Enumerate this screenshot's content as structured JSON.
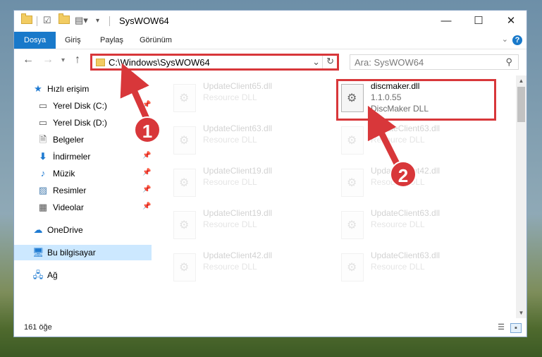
{
  "window": {
    "title": "SysWOW64"
  },
  "ribbon": {
    "tabs": [
      "Dosya",
      "Giriş",
      "Paylaş",
      "Görünüm"
    ]
  },
  "address_bar": {
    "path": "C:\\Windows\\SysWOW64"
  },
  "search": {
    "placeholder": "Ara: SysWOW64"
  },
  "sidebar": {
    "items": [
      {
        "label": "Hızlı erişim",
        "icon": "star-icon"
      },
      {
        "label": "Yerel Disk (C:)",
        "icon": "drive-icon"
      },
      {
        "label": "Yerel Disk (D:)",
        "icon": "drive-icon"
      },
      {
        "label": "Belgeler",
        "icon": "documents-icon"
      },
      {
        "label": "İndirmeler",
        "icon": "download-icon"
      },
      {
        "label": "Müzik",
        "icon": "music-icon"
      },
      {
        "label": "Resimler",
        "icon": "pictures-icon"
      },
      {
        "label": "Videolar",
        "icon": "video-icon"
      },
      {
        "label": "OneDrive",
        "icon": "cloud-icon"
      },
      {
        "label": "Bu bilgisayar",
        "icon": "computer-icon"
      },
      {
        "label": "Ağ",
        "icon": "network-icon"
      }
    ]
  },
  "files": [
    {
      "name": "UpdateClient65.dll",
      "type": "Resource DLL"
    },
    {
      "name": "discmaker.dll",
      "type": "1.1.0.55",
      "desc": "DiscMaker DLL"
    },
    {
      "name": "UpdateClient63.dll",
      "type": "Resource DLL"
    },
    {
      "name": "UpdateClient63.dll",
      "type": "Resource DLL"
    },
    {
      "name": "UpdateClient19.dll",
      "type": "Resource DLL"
    },
    {
      "name": "UpdateClient42.dll",
      "type": "Resource DLL"
    },
    {
      "name": "UpdateClient19.dll",
      "type": "Resource DLL"
    },
    {
      "name": "UpdateClient63.dll",
      "type": "Resource DLL"
    },
    {
      "name": "UpdateClient42.dll",
      "type": "Resource DLL"
    },
    {
      "name": "UpdateClient63.dll",
      "type": "Resource DLL"
    }
  ],
  "status": {
    "count": "161 öğe"
  },
  "callouts": {
    "one": "1",
    "two": "2"
  },
  "colors": {
    "accent": "#1979ca",
    "highlight": "#d8373a",
    "selected": "#cce8ff"
  }
}
